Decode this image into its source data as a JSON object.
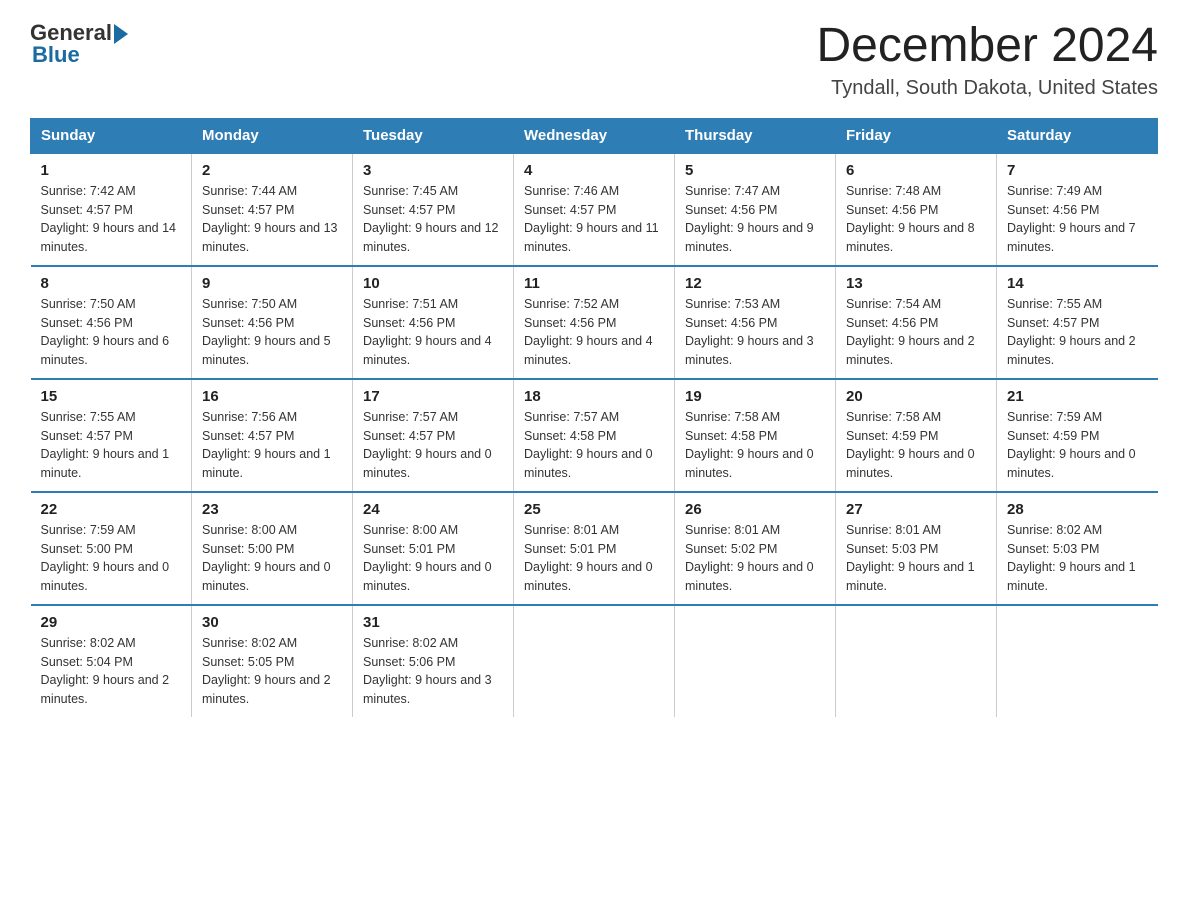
{
  "header": {
    "logo_general": "General",
    "logo_blue": "Blue",
    "month_title": "December 2024",
    "location": "Tyndall, South Dakota, United States"
  },
  "days_of_week": [
    "Sunday",
    "Monday",
    "Tuesday",
    "Wednesday",
    "Thursday",
    "Friday",
    "Saturday"
  ],
  "weeks": [
    [
      {
        "day": "1",
        "sunrise": "7:42 AM",
        "sunset": "4:57 PM",
        "daylight": "9 hours and 14 minutes."
      },
      {
        "day": "2",
        "sunrise": "7:44 AM",
        "sunset": "4:57 PM",
        "daylight": "9 hours and 13 minutes."
      },
      {
        "day": "3",
        "sunrise": "7:45 AM",
        "sunset": "4:57 PM",
        "daylight": "9 hours and 12 minutes."
      },
      {
        "day": "4",
        "sunrise": "7:46 AM",
        "sunset": "4:57 PM",
        "daylight": "9 hours and 11 minutes."
      },
      {
        "day": "5",
        "sunrise": "7:47 AM",
        "sunset": "4:56 PM",
        "daylight": "9 hours and 9 minutes."
      },
      {
        "day": "6",
        "sunrise": "7:48 AM",
        "sunset": "4:56 PM",
        "daylight": "9 hours and 8 minutes."
      },
      {
        "day": "7",
        "sunrise": "7:49 AM",
        "sunset": "4:56 PM",
        "daylight": "9 hours and 7 minutes."
      }
    ],
    [
      {
        "day": "8",
        "sunrise": "7:50 AM",
        "sunset": "4:56 PM",
        "daylight": "9 hours and 6 minutes."
      },
      {
        "day": "9",
        "sunrise": "7:50 AM",
        "sunset": "4:56 PM",
        "daylight": "9 hours and 5 minutes."
      },
      {
        "day": "10",
        "sunrise": "7:51 AM",
        "sunset": "4:56 PM",
        "daylight": "9 hours and 4 minutes."
      },
      {
        "day": "11",
        "sunrise": "7:52 AM",
        "sunset": "4:56 PM",
        "daylight": "9 hours and 4 minutes."
      },
      {
        "day": "12",
        "sunrise": "7:53 AM",
        "sunset": "4:56 PM",
        "daylight": "9 hours and 3 minutes."
      },
      {
        "day": "13",
        "sunrise": "7:54 AM",
        "sunset": "4:56 PM",
        "daylight": "9 hours and 2 minutes."
      },
      {
        "day": "14",
        "sunrise": "7:55 AM",
        "sunset": "4:57 PM",
        "daylight": "9 hours and 2 minutes."
      }
    ],
    [
      {
        "day": "15",
        "sunrise": "7:55 AM",
        "sunset": "4:57 PM",
        "daylight": "9 hours and 1 minute."
      },
      {
        "day": "16",
        "sunrise": "7:56 AM",
        "sunset": "4:57 PM",
        "daylight": "9 hours and 1 minute."
      },
      {
        "day": "17",
        "sunrise": "7:57 AM",
        "sunset": "4:57 PM",
        "daylight": "9 hours and 0 minutes."
      },
      {
        "day": "18",
        "sunrise": "7:57 AM",
        "sunset": "4:58 PM",
        "daylight": "9 hours and 0 minutes."
      },
      {
        "day": "19",
        "sunrise": "7:58 AM",
        "sunset": "4:58 PM",
        "daylight": "9 hours and 0 minutes."
      },
      {
        "day": "20",
        "sunrise": "7:58 AM",
        "sunset": "4:59 PM",
        "daylight": "9 hours and 0 minutes."
      },
      {
        "day": "21",
        "sunrise": "7:59 AM",
        "sunset": "4:59 PM",
        "daylight": "9 hours and 0 minutes."
      }
    ],
    [
      {
        "day": "22",
        "sunrise": "7:59 AM",
        "sunset": "5:00 PM",
        "daylight": "9 hours and 0 minutes."
      },
      {
        "day": "23",
        "sunrise": "8:00 AM",
        "sunset": "5:00 PM",
        "daylight": "9 hours and 0 minutes."
      },
      {
        "day": "24",
        "sunrise": "8:00 AM",
        "sunset": "5:01 PM",
        "daylight": "9 hours and 0 minutes."
      },
      {
        "day": "25",
        "sunrise": "8:01 AM",
        "sunset": "5:01 PM",
        "daylight": "9 hours and 0 minutes."
      },
      {
        "day": "26",
        "sunrise": "8:01 AM",
        "sunset": "5:02 PM",
        "daylight": "9 hours and 0 minutes."
      },
      {
        "day": "27",
        "sunrise": "8:01 AM",
        "sunset": "5:03 PM",
        "daylight": "9 hours and 1 minute."
      },
      {
        "day": "28",
        "sunrise": "8:02 AM",
        "sunset": "5:03 PM",
        "daylight": "9 hours and 1 minute."
      }
    ],
    [
      {
        "day": "29",
        "sunrise": "8:02 AM",
        "sunset": "5:04 PM",
        "daylight": "9 hours and 2 minutes."
      },
      {
        "day": "30",
        "sunrise": "8:02 AM",
        "sunset": "5:05 PM",
        "daylight": "9 hours and 2 minutes."
      },
      {
        "day": "31",
        "sunrise": "8:02 AM",
        "sunset": "5:06 PM",
        "daylight": "9 hours and 3 minutes."
      },
      null,
      null,
      null,
      null
    ]
  ],
  "labels": {
    "sunrise": "Sunrise:",
    "sunset": "Sunset:",
    "daylight": "Daylight:"
  }
}
